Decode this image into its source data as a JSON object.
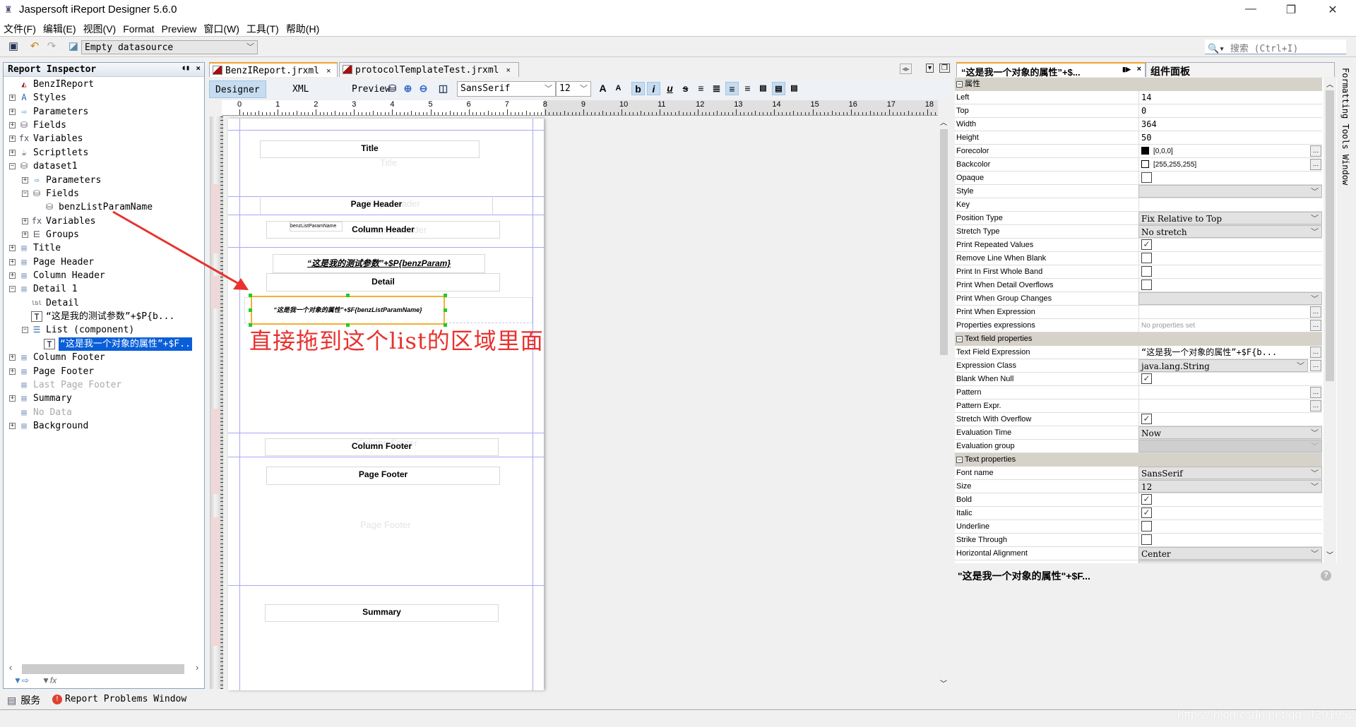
{
  "window": {
    "title": "Jaspersoft iReport Designer 5.6.0",
    "controls": [
      "—",
      "❐",
      "✕"
    ]
  },
  "menu": [
    "文件(F)",
    "编辑(E)",
    "视图(V)",
    "Format",
    "Preview",
    "窗口(W)",
    "工具(T)",
    "帮助(H)"
  ],
  "toolbar": {
    "datasource": "Empty datasource",
    "search_placeholder": "搜索 (Ctrl+I)"
  },
  "inspector": {
    "title": "Report Inspector",
    "items": [
      {
        "label": "BenzIReport",
        "level": 0,
        "icon": "report-icon",
        "exp": ""
      },
      {
        "label": "Styles",
        "level": 0,
        "icon": "styles-icon",
        "exp": "+"
      },
      {
        "label": "Parameters",
        "level": 0,
        "icon": "parameters-icon",
        "exp": "+"
      },
      {
        "label": "Fields",
        "level": 0,
        "icon": "fields-icon",
        "exp": "+"
      },
      {
        "label": "Variables",
        "level": 0,
        "icon": "variables-icon",
        "exp": "+"
      },
      {
        "label": "Scriptlets",
        "level": 0,
        "icon": "scriptlets-icon",
        "exp": "+"
      },
      {
        "label": "dataset1",
        "level": 0,
        "icon": "dataset-icon",
        "exp": "−"
      },
      {
        "label": "Parameters",
        "level": 1,
        "icon": "parameters-icon",
        "exp": "+"
      },
      {
        "label": "Fields",
        "level": 1,
        "icon": "fields-icon",
        "exp": "−"
      },
      {
        "label": "benzListParamName",
        "level": 2,
        "icon": "field-icon",
        "exp": ""
      },
      {
        "label": "Variables",
        "level": 1,
        "icon": "variables-icon",
        "exp": "+"
      },
      {
        "label": "Groups",
        "level": 1,
        "icon": "groups-icon",
        "exp": "+"
      },
      {
        "label": "Title",
        "level": 0,
        "icon": "band-icon",
        "exp": "+"
      },
      {
        "label": "Page Header",
        "level": 0,
        "icon": "band-icon",
        "exp": "+"
      },
      {
        "label": "Column Header",
        "level": 0,
        "icon": "band-icon",
        "exp": "+"
      },
      {
        "label": "Detail 1",
        "level": 0,
        "icon": "band-icon",
        "exp": "−"
      },
      {
        "label": "Detail",
        "level": 1,
        "icon": "label-icon",
        "exp": ""
      },
      {
        "label": "“这是我的测试参数”+$P{b...",
        "level": 1,
        "icon": "textfield-icon",
        "exp": ""
      },
      {
        "label": "List (component)",
        "level": 1,
        "icon": "list-icon",
        "exp": "−"
      },
      {
        "label": "“这是我一个对象的属性”+$F..",
        "level": 2,
        "icon": "textfield-icon",
        "exp": "",
        "selected": true
      },
      {
        "label": "Column Footer",
        "level": 0,
        "icon": "band-icon",
        "exp": "+"
      },
      {
        "label": "Page Footer",
        "level": 0,
        "icon": "band-icon",
        "exp": "+"
      },
      {
        "label": "Last Page Footer",
        "level": 0,
        "icon": "band-icon",
        "exp": "",
        "disabled": true
      },
      {
        "label": "Summary",
        "level": 0,
        "icon": "band-icon",
        "exp": "+"
      },
      {
        "label": "No Data",
        "level": 0,
        "icon": "band-icon",
        "exp": "",
        "disabled": true
      },
      {
        "label": "Background",
        "level": 0,
        "icon": "band-icon",
        "exp": "+"
      }
    ]
  },
  "editor": {
    "tabs": [
      {
        "label": "BenzIReport.jrxml",
        "active": true
      },
      {
        "label": "protocolTemplateTest.jrxml",
        "active": false
      }
    ],
    "views": [
      "Designer",
      "XML",
      "Preview"
    ],
    "font": "SansSerif",
    "size": "12",
    "ruler": [
      "0",
      "1",
      "2",
      "3",
      "4",
      "5",
      "6",
      "7",
      "8",
      "9",
      "10",
      "11",
      "12",
      "13",
      "14",
      "15",
      "16",
      "17",
      "18"
    ],
    "bands": {
      "title": "Title",
      "title_ghost": "Title",
      "page_header": "Page Header",
      "page_header_ghost": "Page Header",
      "field_label": "benzListParamName",
      "column_header": "Column Header",
      "column_header_ghost": "Column Header",
      "param_field": "“这是我的测试参数”+$P{benzParam}",
      "detail": "Detail",
      "list_field": "“这是我一个对象的属性”+$F{benzListParamName}",
      "detail_ghost": "Detail 1",
      "column_footer": "Column Footer",
      "column_footer_ghost": "Column Footer",
      "page_footer": "Page Footer",
      "page_footer_ghost": "Page Footer",
      "summary": "Summary"
    },
    "annotation": "直接拖到这个list的区域里面",
    "annotation_color": "#e8322f"
  },
  "properties": {
    "tab": "“这是我一个对象的属性”+$...",
    "palette_tab": "组件面板",
    "side_label": "Formatting Tools Window",
    "sections": [
      {
        "title": "属性",
        "rows": [
          {
            "label": "Left",
            "type": "text",
            "value": "14"
          },
          {
            "label": "Top",
            "type": "text",
            "value": "0"
          },
          {
            "label": "Width",
            "type": "text",
            "value": "364"
          },
          {
            "label": "Height",
            "type": "text",
            "value": "50"
          },
          {
            "label": "Forecolor",
            "type": "color",
            "value": "[0,0,0]",
            "color": "#000000",
            "button": true
          },
          {
            "label": "Backcolor",
            "type": "color",
            "value": "[255,255,255]",
            "color": "#ffffff",
            "button": true
          },
          {
            "label": "Opaque",
            "type": "check",
            "checked": false
          },
          {
            "label": "Style",
            "type": "combo",
            "value": ""
          },
          {
            "label": "Key",
            "type": "text",
            "value": ""
          },
          {
            "label": "Position Type",
            "type": "combo",
            "value": "Fix Relative to Top"
          },
          {
            "label": "Stretch Type",
            "type": "combo",
            "value": "No stretch"
          },
          {
            "label": "Print Repeated Values",
            "type": "check",
            "checked": true
          },
          {
            "label": "Remove Line When Blank",
            "type": "check",
            "checked": false
          },
          {
            "label": "Print In First Whole Band",
            "type": "check",
            "checked": false
          },
          {
            "label": "Print When Detail Overflows",
            "type": "check",
            "checked": false
          },
          {
            "label": "Print When Group Changes",
            "type": "combo",
            "value": ""
          },
          {
            "label": "Print When Expression",
            "type": "text",
            "value": "",
            "button": true
          },
          {
            "label": "Properties expressions",
            "type": "hint",
            "value": "No properties set",
            "button": true
          }
        ]
      },
      {
        "title": "Text field properties",
        "rows": [
          {
            "label": "Text Field Expression",
            "type": "text",
            "value": "“这是我一个对象的属性”+$F{b...",
            "button": true
          },
          {
            "label": "Expression Class",
            "type": "combo",
            "value": "java.lang.String",
            "button": true
          },
          {
            "label": "Blank When Null",
            "type": "check",
            "checked": true
          },
          {
            "label": "Pattern",
            "type": "text",
            "value": "",
            "button": true
          },
          {
            "label": "Pattern Expr.",
            "type": "text",
            "value": "",
            "button": true
          },
          {
            "label": "Stretch With Overflow",
            "type": "check",
            "checked": true
          },
          {
            "label": "Evaluation Time",
            "type": "combo",
            "value": "Now"
          },
          {
            "label": "Evaluation group",
            "type": "disabled",
            "value": ""
          }
        ]
      },
      {
        "title": "Text properties",
        "rows": [
          {
            "label": "Font name",
            "type": "combo",
            "value": "SansSerif"
          },
          {
            "label": "Size",
            "type": "combo",
            "value": "12"
          },
          {
            "label": "Bold",
            "type": "check",
            "checked": true
          },
          {
            "label": "Italic",
            "type": "check",
            "checked": true
          },
          {
            "label": "Underline",
            "type": "check",
            "checked": false
          },
          {
            "label": "Strike Through",
            "type": "check",
            "checked": false
          },
          {
            "label": "Horizontal Alignment",
            "type": "combo",
            "value": "Center"
          },
          {
            "label": "Vertical Alignment",
            "type": "combo",
            "value": "Middle"
          }
        ]
      }
    ],
    "description": "\"这是我一个对象的属性\"+$F..."
  },
  "statusbar": {
    "services": "服务",
    "problems": "Report Problems Window"
  },
  "watermark": "https://blog.csdn.net/qq_42919520"
}
